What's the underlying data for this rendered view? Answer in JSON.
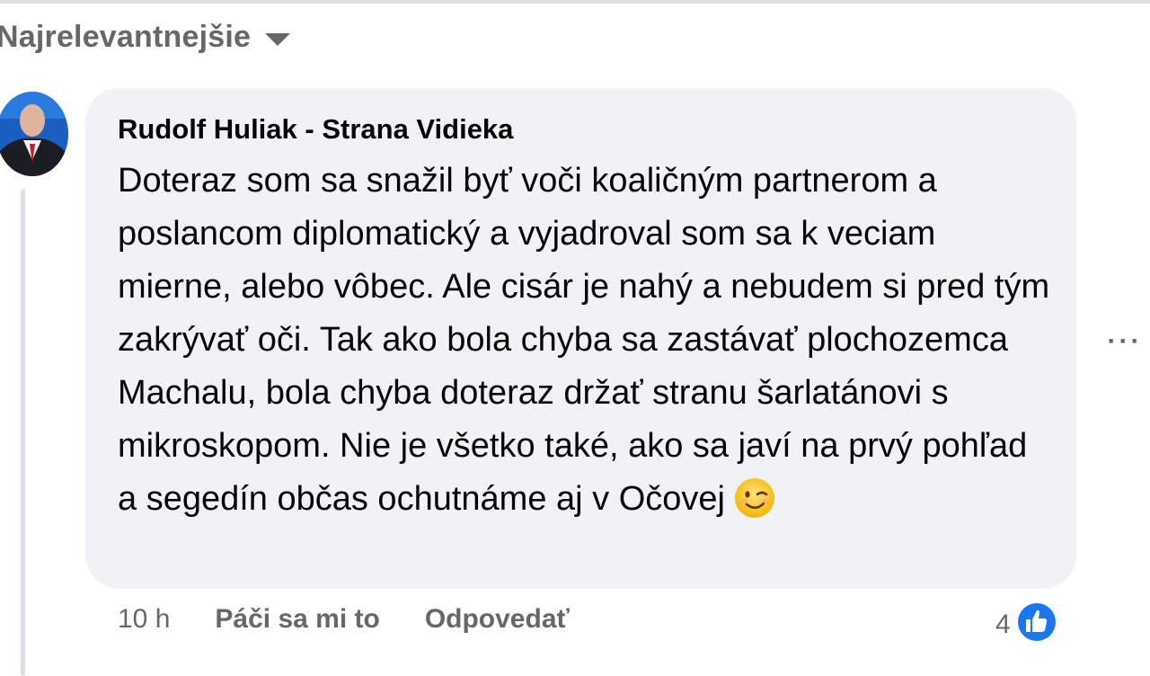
{
  "sort": {
    "label": "Najrelevantnejšie",
    "icon": "caret-down-icon"
  },
  "comment": {
    "author": "Rudolf Huliak - Strana Vidieka",
    "text": "Doteraz som sa snažil byť voči koaličným partnerom a poslancom diplomatický a vyjadroval som sa k veciam mierne, alebo vôbec. Ale cisár je nahý a nebudem si pred tým zakrývať oči. Tak ako bola chyba sa zastávať plochozemca Machalu, bola chyba doteraz držať stranu šarlatánovi s mikroskopom. Nie je všetko také, ako sa javí na prvý pohľad a segedín občas ochutnáme aj v Očovej",
    "emoji": "winking-face-emoji",
    "timestamp": "10 h",
    "like_label": "Páči sa mi to",
    "reply_label": "Odpovedať",
    "reaction_count": "4",
    "reaction_icon": "like-thumb-icon",
    "more_icon": "more-options-icon",
    "more_symbol": "···"
  },
  "colors": {
    "bubble": "#f0f2f5",
    "secondary_text": "#65676b",
    "primary_text": "#050505",
    "like_blue": "#1877f2"
  }
}
